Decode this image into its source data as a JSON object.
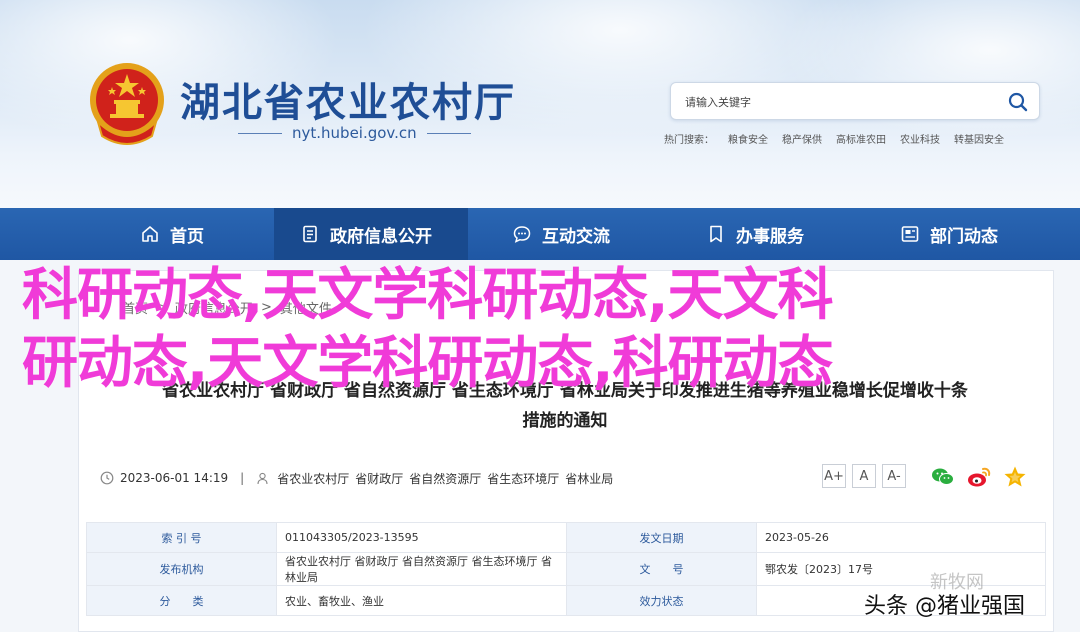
{
  "header": {
    "title": "湖北省农业农村厅",
    "domain": "nyt.hubei.gov.cn",
    "search_placeholder": "请输入关键字",
    "hot_label": "热门搜索：",
    "hot_links": [
      "粮食安全",
      "稳产保供",
      "高标准农田",
      "农业科技",
      "转基因安全"
    ]
  },
  "nav": {
    "items": [
      {
        "label": "首页",
        "icon": "home-icon"
      },
      {
        "label": "政府信息公开",
        "icon": "document-icon"
      },
      {
        "label": "互动交流",
        "icon": "chat-icon"
      },
      {
        "label": "办事服务",
        "icon": "bookmark-icon"
      },
      {
        "label": "部门动态",
        "icon": "news-icon"
      }
    ],
    "active_index": 1
  },
  "breadcrumb": [
    "首页",
    "政府信息公开",
    "其他文件"
  ],
  "article": {
    "title_line1": "省农业农村厅 省财政厅 省自然资源厅 省生态环境厅 省林业局关于印发推进生猪等养殖业稳增长促增收十条",
    "title_line2": "措施的通知",
    "date": "2023-06-01 14:19",
    "sources": [
      "省农业农村厅",
      "省财政厅",
      "省自然资源厅",
      "省生态环境厅",
      "省林业局"
    ],
    "font_buttons": [
      "A+",
      "A",
      "A-"
    ]
  },
  "info_table": {
    "rows": [
      {
        "k1": "索 引 号",
        "v1": "011043305/2023-13595",
        "k2": "发文日期",
        "v2": "2023-05-26"
      },
      {
        "k1": "发布机构",
        "v1": "省农业农村厅 省财政厅 省自然资源厅 省生态环境厅 省林业局",
        "k2": "文　　号",
        "v2": "鄂农发〔2023〕17号"
      },
      {
        "k1": "分　　类",
        "v1": "农业、畜牧业、渔业",
        "k2": "效力状态",
        "v2": ""
      }
    ]
  },
  "overlay": {
    "caption_line1": "科研动态,天文学科研动态,天文科",
    "caption_line2": "研动态,天文学科研动态,科研动态",
    "watermark_faint": "新牧网",
    "watermark": "头条 @猪业强国"
  },
  "colors": {
    "brand_blue": "#1f57a4",
    "nav_active": "#194a8e",
    "title_blue": "#1f4e96",
    "overlay_magenta": "#f03bd8"
  }
}
